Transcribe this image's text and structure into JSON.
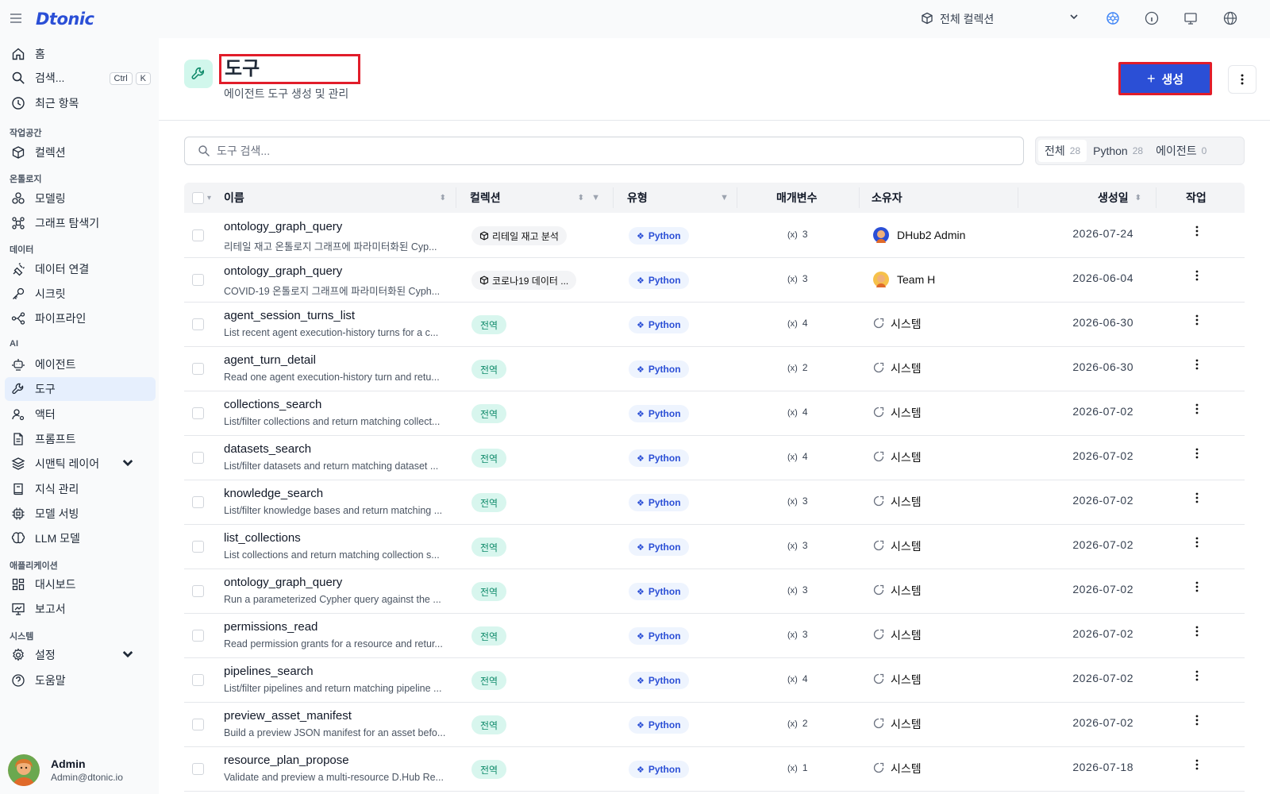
{
  "header": {
    "logo": "Dtonic",
    "collection_selector": "전체 컬렉션"
  },
  "sidebar": {
    "items": [
      {
        "label": "홈",
        "icon": "home-icon"
      },
      {
        "label": "검색...",
        "icon": "search-icon",
        "kbd": [
          "Ctrl",
          "K"
        ]
      },
      {
        "label": "최근 항목",
        "icon": "clock-icon"
      }
    ],
    "sections": [
      {
        "title": "작업공간",
        "items": [
          {
            "label": "컬렉션",
            "icon": "cube-icon"
          }
        ]
      },
      {
        "title": "온톨로지",
        "items": [
          {
            "label": "모델링",
            "icon": "modeling-icon"
          },
          {
            "label": "그래프 탐색기",
            "icon": "graph-icon"
          }
        ]
      },
      {
        "title": "데이터",
        "items": [
          {
            "label": "데이터 연결",
            "icon": "plug-icon"
          },
          {
            "label": "시크릿",
            "icon": "key-icon"
          },
          {
            "label": "파이프라인",
            "icon": "pipeline-icon"
          }
        ]
      },
      {
        "title": "AI",
        "items": [
          {
            "label": "에이전트",
            "icon": "robot-icon"
          },
          {
            "label": "도구",
            "icon": "wrench-icon"
          },
          {
            "label": "액터",
            "icon": "actor-icon"
          },
          {
            "label": "프롬프트",
            "icon": "document-icon"
          },
          {
            "label": "시맨틱 레이어",
            "icon": "layers-icon"
          },
          {
            "label": "지식 관리",
            "icon": "book-icon"
          },
          {
            "label": "모델 서빙",
            "icon": "chip-icon"
          },
          {
            "label": "LLM 모델",
            "icon": "brain-icon"
          }
        ]
      },
      {
        "title": "애플리케이션",
        "items": [
          {
            "label": "대시보드",
            "icon": "dashboard-icon"
          },
          {
            "label": "보고서",
            "icon": "report-icon"
          }
        ]
      },
      {
        "title": "시스템",
        "items": [
          {
            "label": "설정",
            "icon": "gear-icon"
          },
          {
            "label": "도움말",
            "icon": "help-icon"
          }
        ]
      }
    ],
    "user": {
      "name": "Admin",
      "email": "Admin@dtonic.io"
    }
  },
  "page": {
    "title": "도구",
    "subtitle": "에이전트 도구 생성 및 관리",
    "create_label": "생성",
    "search_placeholder": "도구 검색...",
    "filters": [
      {
        "label": "전체",
        "count": "28"
      },
      {
        "label": "Python",
        "count": "28"
      },
      {
        "label": "에이전트",
        "count": "0"
      }
    ]
  },
  "table": {
    "columns": [
      "이름",
      "컬렉션",
      "유형",
      "매개변수",
      "소유자",
      "생성일",
      "작업"
    ],
    "rows": [
      {
        "name": "ontology_graph_query",
        "desc": "리테일 재고 온톨로지 그래프에 파라미터화된 Cyp...",
        "collection": "리테일 재고 분석",
        "global": false,
        "type": "Python",
        "params": "3",
        "owner": "DHub2 Admin",
        "owner_kind": "admin",
        "date": "2026-07-24"
      },
      {
        "name": "ontology_graph_query",
        "desc": "COVID-19 온톨로지 그래프에 파라미터화된 Cyph...",
        "collection": "코로나19 데이터 ...",
        "global": false,
        "type": "Python",
        "params": "3",
        "owner": "Team H",
        "owner_kind": "team",
        "date": "2026-06-04"
      },
      {
        "name": "agent_session_turns_list",
        "desc": "List recent agent execution-history turns for a c...",
        "collection": "전역",
        "global": true,
        "type": "Python",
        "params": "4",
        "owner": "시스템",
        "owner_kind": "system",
        "date": "2026-06-30"
      },
      {
        "name": "agent_turn_detail",
        "desc": "Read one agent execution-history turn and retu...",
        "collection": "전역",
        "global": true,
        "type": "Python",
        "params": "2",
        "owner": "시스템",
        "owner_kind": "system",
        "date": "2026-06-30"
      },
      {
        "name": "collections_search",
        "desc": "List/filter collections and return matching collect...",
        "collection": "전역",
        "global": true,
        "type": "Python",
        "params": "4",
        "owner": "시스템",
        "owner_kind": "system",
        "date": "2026-07-02"
      },
      {
        "name": "datasets_search",
        "desc": "List/filter datasets and return matching dataset ...",
        "collection": "전역",
        "global": true,
        "type": "Python",
        "params": "4",
        "owner": "시스템",
        "owner_kind": "system",
        "date": "2026-07-02"
      },
      {
        "name": "knowledge_search",
        "desc": "List/filter knowledge bases and return matching ...",
        "collection": "전역",
        "global": true,
        "type": "Python",
        "params": "3",
        "owner": "시스템",
        "owner_kind": "system",
        "date": "2026-07-02"
      },
      {
        "name": "list_collections",
        "desc": "List collections and return matching collection s...",
        "collection": "전역",
        "global": true,
        "type": "Python",
        "params": "3",
        "owner": "시스템",
        "owner_kind": "system",
        "date": "2026-07-02"
      },
      {
        "name": "ontology_graph_query",
        "desc": "Run a parameterized Cypher query against the ...",
        "collection": "전역",
        "global": true,
        "type": "Python",
        "params": "3",
        "owner": "시스템",
        "owner_kind": "system",
        "date": "2026-07-02"
      },
      {
        "name": "permissions_read",
        "desc": "Read permission grants for a resource and retur...",
        "collection": "전역",
        "global": true,
        "type": "Python",
        "params": "3",
        "owner": "시스템",
        "owner_kind": "system",
        "date": "2026-07-02"
      },
      {
        "name": "pipelines_search",
        "desc": "List/filter pipelines and return matching pipeline ...",
        "collection": "전역",
        "global": true,
        "type": "Python",
        "params": "4",
        "owner": "시스템",
        "owner_kind": "system",
        "date": "2026-07-02"
      },
      {
        "name": "preview_asset_manifest",
        "desc": "Build a preview JSON manifest for an asset befo...",
        "collection": "전역",
        "global": true,
        "type": "Python",
        "params": "2",
        "owner": "시스템",
        "owner_kind": "system",
        "date": "2026-07-02"
      },
      {
        "name": "resource_plan_propose",
        "desc": "Validate and preview a multi-resource D.Hub Re...",
        "collection": "전역",
        "global": true,
        "type": "Python",
        "params": "1",
        "owner": "시스템",
        "owner_kind": "system",
        "date": "2026-07-18"
      }
    ]
  },
  "colors": {
    "accent": "#2b4fd6",
    "highlight": "#e11d2a",
    "global_badge": "#d8f6ee"
  }
}
